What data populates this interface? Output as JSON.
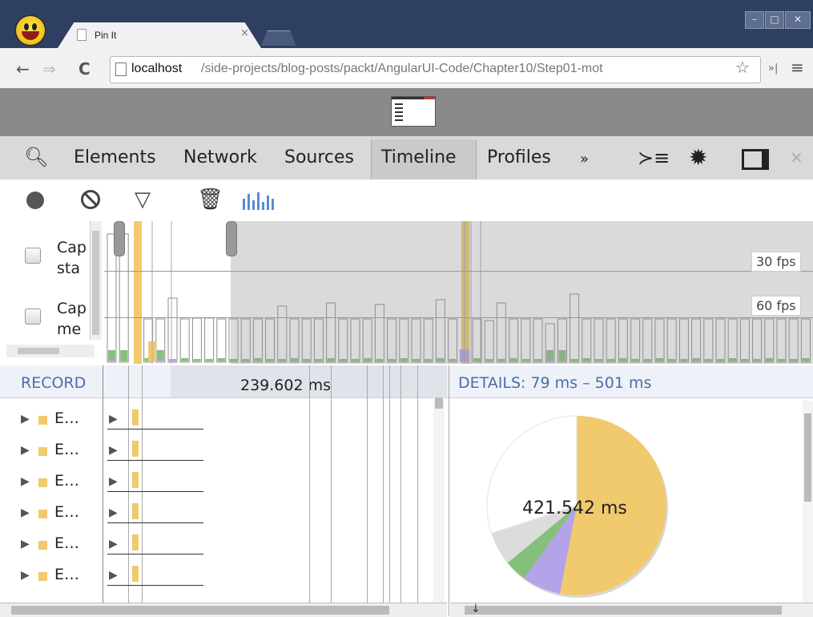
{
  "browser": {
    "tab_title": "Pin It",
    "tab_close": "×",
    "url_host": "localhost",
    "url_path": "/side-projects/blog-posts/packt/AngularUI-Code/Chapter10/Step01-mot",
    "window_controls": [
      "–",
      "□",
      "✕"
    ]
  },
  "devtools": {
    "tabs": [
      "Elements",
      "Network",
      "Sources",
      "Timeline",
      "Profiles"
    ],
    "active_tab": "Timeline",
    "more_tabs": "»",
    "close": "×",
    "options": [
      "Cap sta",
      "Cap me"
    ],
    "fps_labels": [
      "30 fps",
      "60 fps"
    ],
    "records_title": "RECORD",
    "records_duration": "239.602 ms",
    "records": [
      "E…",
      "E…",
      "E…",
      "E…",
      "E…",
      "E…"
    ],
    "details_title": "DETAILS: 79 ms – 501 ms",
    "pie_total": "421.542 ms"
  },
  "colors": {
    "scripting": "#f1ca6e",
    "rendering": "#b3a3e8",
    "painting": "#84c07b",
    "other": "#dcdcdc",
    "accent_blue": "#4a6da8"
  },
  "pie_fractions": {
    "scripting": 0.53,
    "rendering": 0.07,
    "painting": 0.04,
    "other": 0.06,
    "idle": 0.3
  }
}
